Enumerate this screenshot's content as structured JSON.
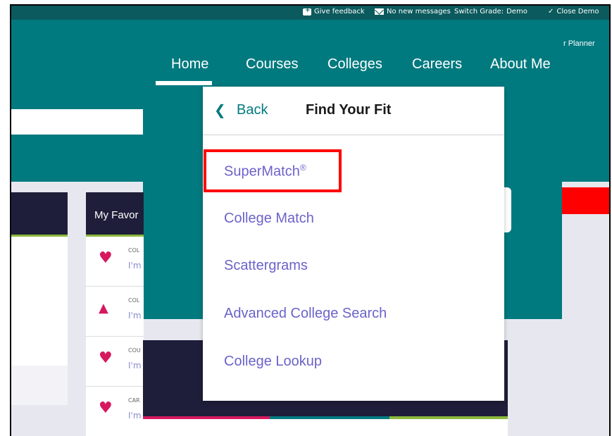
{
  "util_bar": {
    "feedback": "Give feedback",
    "messages": "No new messages",
    "switch_grade_label": "Switch Grade:",
    "switch_grade_value": "Demo",
    "close_demo": "Close Demo"
  },
  "header": {
    "planner_fragment": "r Planner",
    "nav": [
      "Home",
      "Courses",
      "Colleges",
      "Careers",
      "About Me"
    ]
  },
  "favorites": {
    "title": "My Favor",
    "rows": [
      {
        "icon": "heart-icon",
        "category": "COL",
        "subtext": "I'm"
      },
      {
        "icon": "graduation-cap-icon",
        "category": "COL",
        "subtext": "I'm"
      },
      {
        "icon": "heart-icon",
        "category": "COU",
        "subtext": "I'm"
      },
      {
        "icon": "heart-icon",
        "category": "CAR",
        "subtext": "I'm"
      }
    ]
  },
  "dropdown": {
    "back_label": "Back",
    "title": "Find Your Fit",
    "items": [
      "SuperMatch",
      "College Match",
      "Scattergrams",
      "Advanced College Search",
      "College Lookup"
    ],
    "supermatch_mark": "®"
  },
  "colors": {
    "teal": "#007a7f",
    "util_teal": "#0b5a5d",
    "navy": "#1f1e3a",
    "link_purple": "#6b63c9",
    "highlight_red": "#ff0000",
    "heart_pink": "#d6185f",
    "accent_green": "#8ab83c"
  }
}
